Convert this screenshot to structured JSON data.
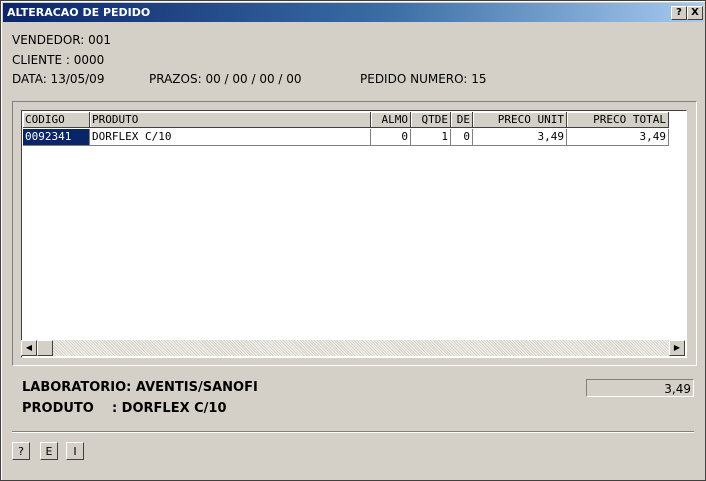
{
  "window": {
    "title": "ALTERACAO DE PEDIDO",
    "help_btn": "?",
    "close_btn": "X"
  },
  "header": {
    "vendedor": "VENDEDOR: 001",
    "cliente": "CLIENTE : 0000",
    "data": "DATA: 13/05/09",
    "prazos": "PRAZOS: 00 / 00 / 00 / 00",
    "pedido": "PEDIDO NUMERO: 15"
  },
  "grid": {
    "columns": [
      "CODIGO",
      "PRODUTO",
      "ALMO",
      "QTDE",
      "DE",
      "PRECO UNIT",
      "PRECO TOTAL"
    ],
    "rows": [
      {
        "codigo": "0092341",
        "produto": "DORFLEX C/10",
        "almo": "0",
        "qtde": "1",
        "de": "0",
        "preco_unit": "3,49",
        "preco_total": "3,49"
      }
    ],
    "selected_cell": "codigo"
  },
  "footer": {
    "laboratorio": "LABORATORIO: AVENTIS/SANOFI",
    "produto": "PRODUTO    : DORFLEX C/10",
    "total": "3,49"
  },
  "buttons": {
    "help": "?",
    "e": "E",
    "i": "I"
  },
  "colors": {
    "titlebar_start": "#0a246a",
    "titlebar_end": "#a6caf0",
    "selection": "#0a246a",
    "window_bg": "#d4d0c8"
  }
}
